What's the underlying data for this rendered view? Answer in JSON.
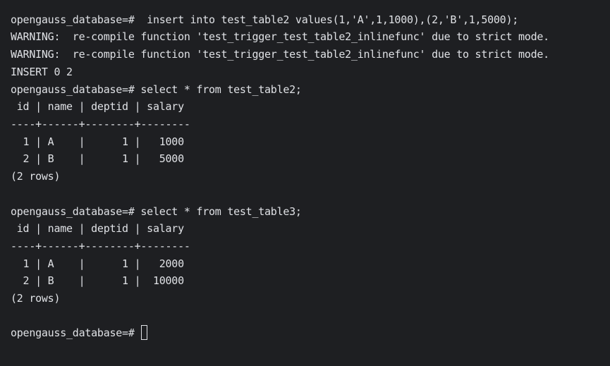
{
  "terminal": {
    "lines": [
      "opengauss_database=#  insert into test_table2 values(1,'A',1,1000),(2,'B',1,5000);",
      "WARNING:  re-compile function 'test_trigger_test_table2_inlinefunc' due to strict mode.",
      "WARNING:  re-compile function 'test_trigger_test_table2_inlinefunc' due to strict mode.",
      "INSERT 0 2",
      "opengauss_database=# select * from test_table2;",
      " id | name | deptid | salary",
      "----+------+--------+--------",
      "  1 | A    |      1 |   1000",
      "  2 | B    |      1 |   5000",
      "(2 rows)",
      "",
      "opengauss_database=# select * from test_table3;",
      " id | name | deptid | salary",
      "----+------+--------+--------",
      "  1 | A    |      1 |   2000",
      "  2 | B    |      1 |  10000",
      "(2 rows)",
      "",
      "opengauss_database=# "
    ]
  }
}
